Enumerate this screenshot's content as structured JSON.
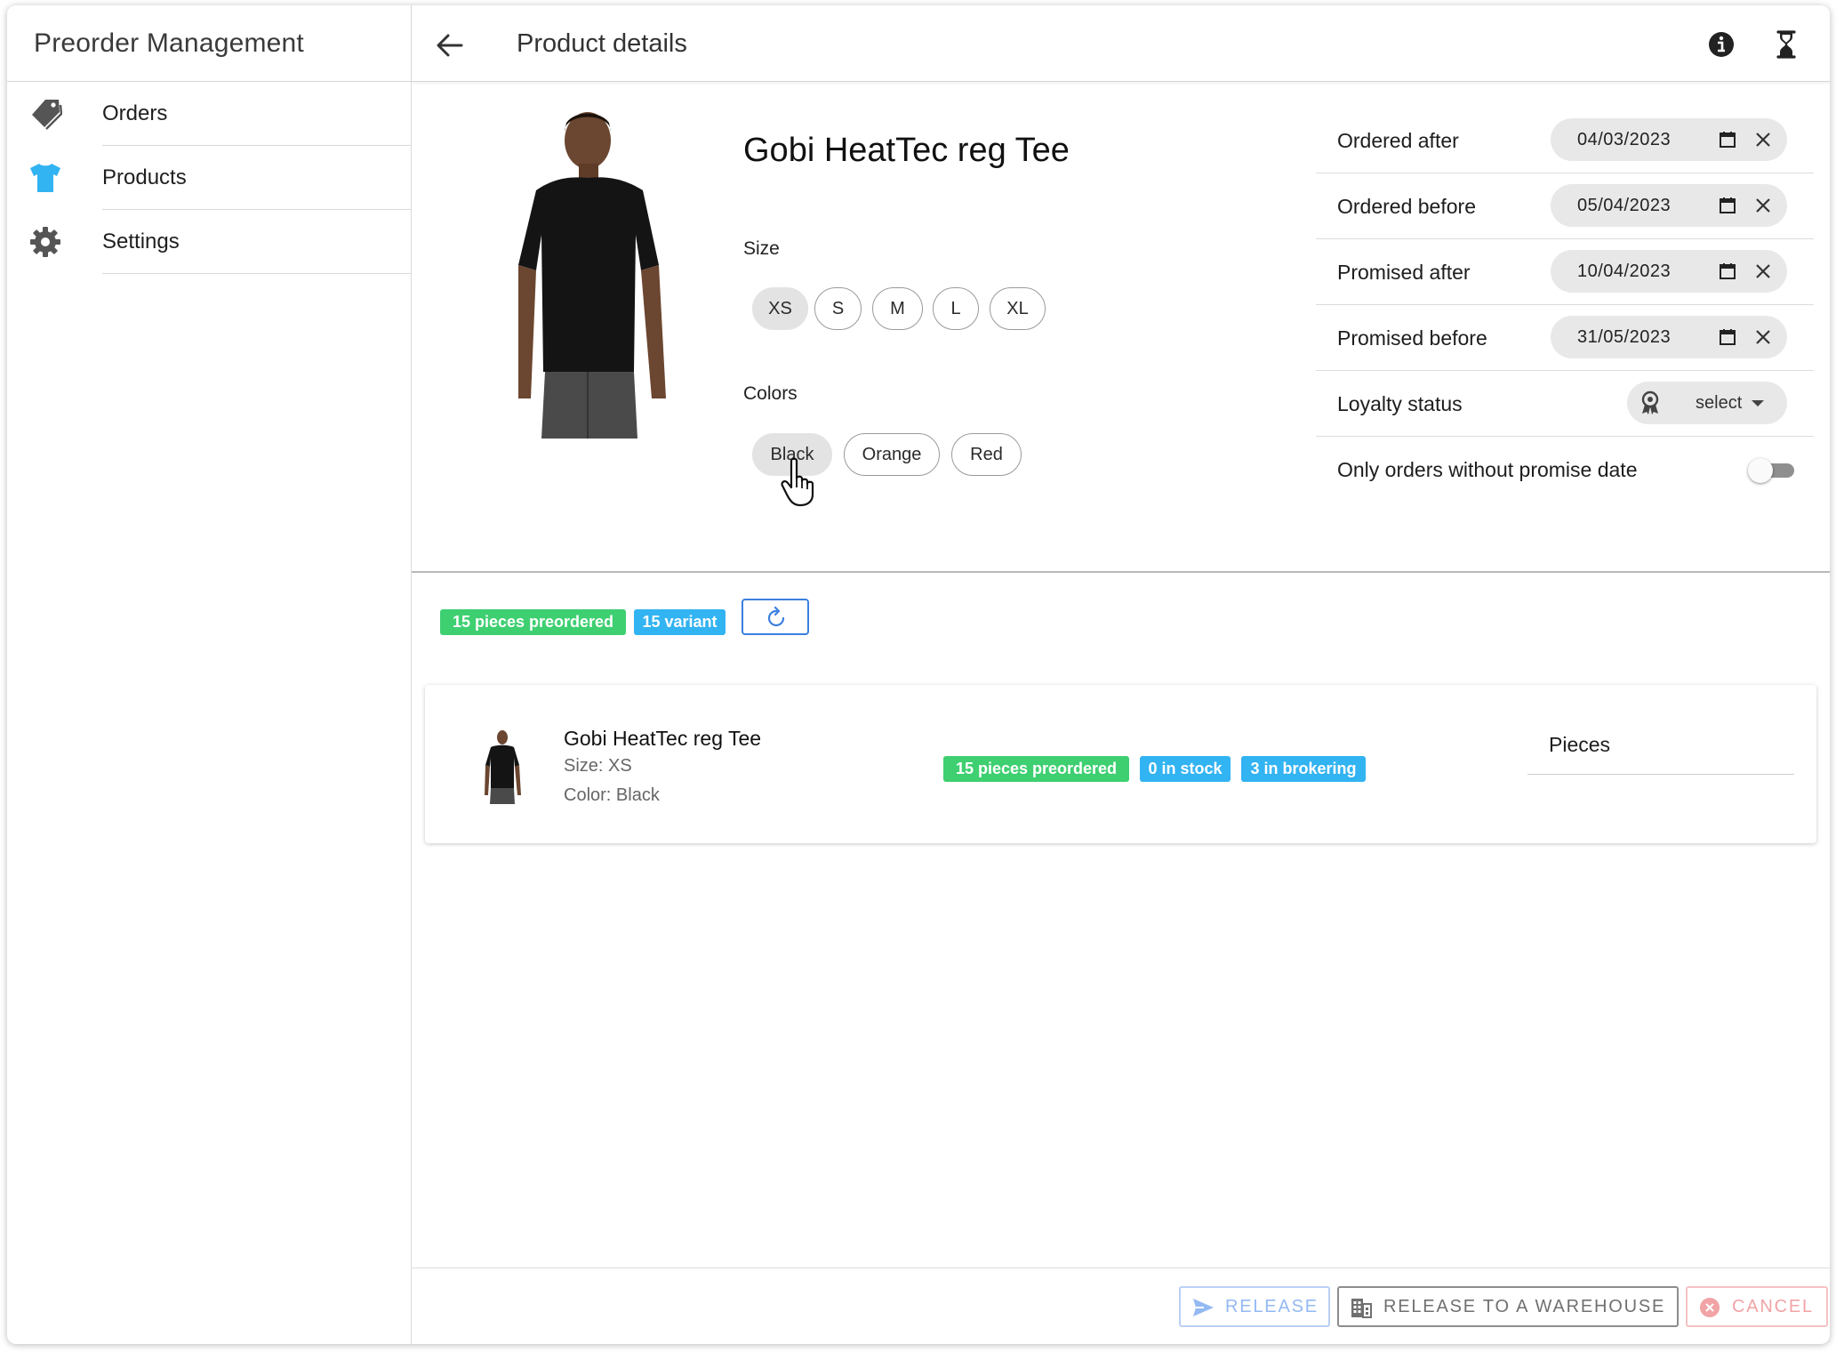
{
  "sidebar": {
    "title": "Preorder Management",
    "items": [
      {
        "label": "Orders",
        "icon": "pricetags-icon",
        "color": "#555555"
      },
      {
        "label": "Products",
        "icon": "shirt-icon",
        "color": "#32b3f2"
      },
      {
        "label": "Settings",
        "icon": "gear-icon",
        "color": "#555555"
      }
    ]
  },
  "header": {
    "title": "Product details",
    "icons": [
      "back-arrow-icon",
      "info-icon",
      "hourglass-icon"
    ]
  },
  "product": {
    "name": "Gobi HeatTec reg Tee",
    "size_label": "Size",
    "sizes": [
      "XS",
      "S",
      "M",
      "L",
      "XL"
    ],
    "selected_size": "XS",
    "colors_label": "Colors",
    "colors": [
      "Black",
      "Orange",
      "Red"
    ],
    "selected_color": "Black"
  },
  "filters": {
    "ordered_after": {
      "label": "Ordered after",
      "value": "04/03/2023"
    },
    "ordered_before": {
      "label": "Ordered before",
      "value": "05/04/2023"
    },
    "promised_after": {
      "label": "Promised after",
      "value": "10/04/2023"
    },
    "promised_before": {
      "label": "Promised before",
      "value": "31/05/2023"
    },
    "loyalty": {
      "label": "Loyalty status",
      "value": "select"
    },
    "no_promise": {
      "label": "Only orders without promise date",
      "enabled": false
    }
  },
  "summary": {
    "preordered": "15 pieces preordered",
    "variants": "15 variant"
  },
  "variant": {
    "name": "Gobi HeatTec reg Tee",
    "size": "Size: XS",
    "color": "Color: Black",
    "badges": [
      "15 pieces preordered",
      "0 in stock",
      "3 in brokering"
    ],
    "pieces_label": "Pieces"
  },
  "footer": {
    "release": "RELEASE",
    "release_warehouse": "RELEASE TO A WAREHOUSE",
    "cancel": "CANCEL"
  },
  "colors": {
    "accent_blue": "#3b7fe0",
    "badge_green": "#3ecf71",
    "badge_blue": "#32b3f2",
    "cancel_red": "#f1a3a6"
  }
}
